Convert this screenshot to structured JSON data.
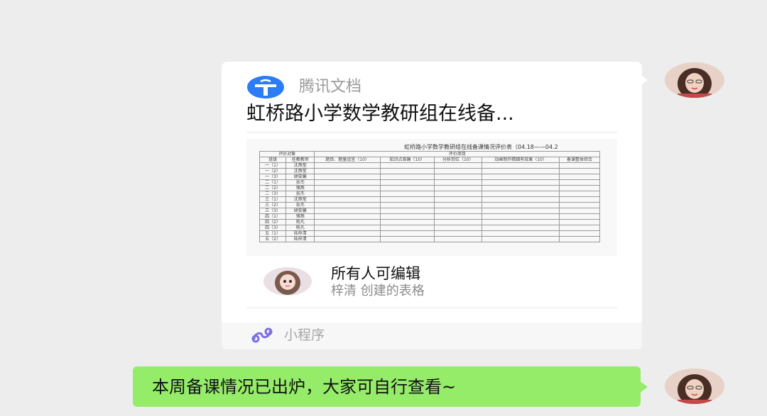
{
  "chat": {
    "card": {
      "brand": "腾讯文档",
      "title": "虹桥路小学数学教研组在线备...",
      "preview": {
        "sheet_title": "虹桥路小学数学教研组在线备课情况评价表（04.18——04.2",
        "header_row1": [
          "评价对象",
          "评价项目"
        ],
        "header_row2": [
          "班级",
          "任教教师",
          "题目、题量适宜（10）",
          "知识点准确（10）",
          "分析到位（10）",
          "动画制作精细有效果（10）",
          "备课整体综合"
        ],
        "rows": [
          [
            "一（1）",
            "沈燕莹"
          ],
          [
            "一（2）",
            "沈燕莹"
          ],
          [
            "一（3）",
            "顾雯馨"
          ],
          [
            "二（1）",
            "张杰"
          ],
          [
            "二（2）",
            "锗燕"
          ],
          [
            "二（3）",
            "张杰"
          ],
          [
            "三（1）",
            "沈燕莹"
          ],
          [
            "三（2）",
            "张杰"
          ],
          [
            "三（3）",
            "顾雯馨"
          ],
          [
            "四（1）",
            "锗燕"
          ],
          [
            "四（2）",
            "杨凡"
          ],
          [
            "四（3）",
            "杨凡"
          ],
          [
            "五（1）",
            "陆梓清"
          ],
          [
            "五（2）",
            "陆梓清"
          ]
        ]
      },
      "permission": "所有人可编辑",
      "creator": "梓清 创建的表格",
      "footer_label": "小程序"
    },
    "message": "本周备课情况已出炉，大家可自行查看~"
  },
  "icons": {
    "brand": "tencent-docs-logo",
    "miniprogram": "miniprogram-icon",
    "avatar": "avatar"
  },
  "colors": {
    "background": "#ededed",
    "card": "#ffffff",
    "bubble": "#95ec69",
    "brand_blue": "#2b7cf6",
    "miniprogram_purple": "#7c6fe0"
  }
}
